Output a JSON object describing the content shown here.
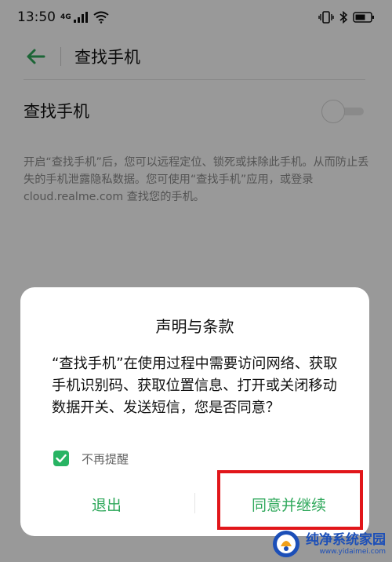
{
  "status_bar": {
    "time": "13:50",
    "network": "4G"
  },
  "header": {
    "title": "查找手机"
  },
  "setting_row": {
    "label": "查找手机",
    "toggle_on": false
  },
  "description": "开启“查找手机”后，您可以远程定位、锁死或抹除此手机。从而防止丢失的手机泄露隐私数据。您可使用“查找手机”应用，或登录 cloud.realme.com 查找您的手机。",
  "dialog": {
    "title": "声明与条款",
    "body": "“查找手机”在使用过程中需要访问网络、获取手机识别码、获取位置信息、打开或关闭移动数据开关、发送短信，您是否同意？",
    "checkbox_label": "不再提醒",
    "checkbox_checked": true,
    "exit_button": "退出",
    "agree_button": "同意并继续"
  },
  "watermark": {
    "title": "纯净系统家园",
    "url": "www.yidaimei.com"
  },
  "colors": {
    "accent_green": "#2fa85b",
    "checkbox_green": "#28b463",
    "highlight_red": "#e1161a",
    "watermark_blue": "#1c4fb8"
  }
}
